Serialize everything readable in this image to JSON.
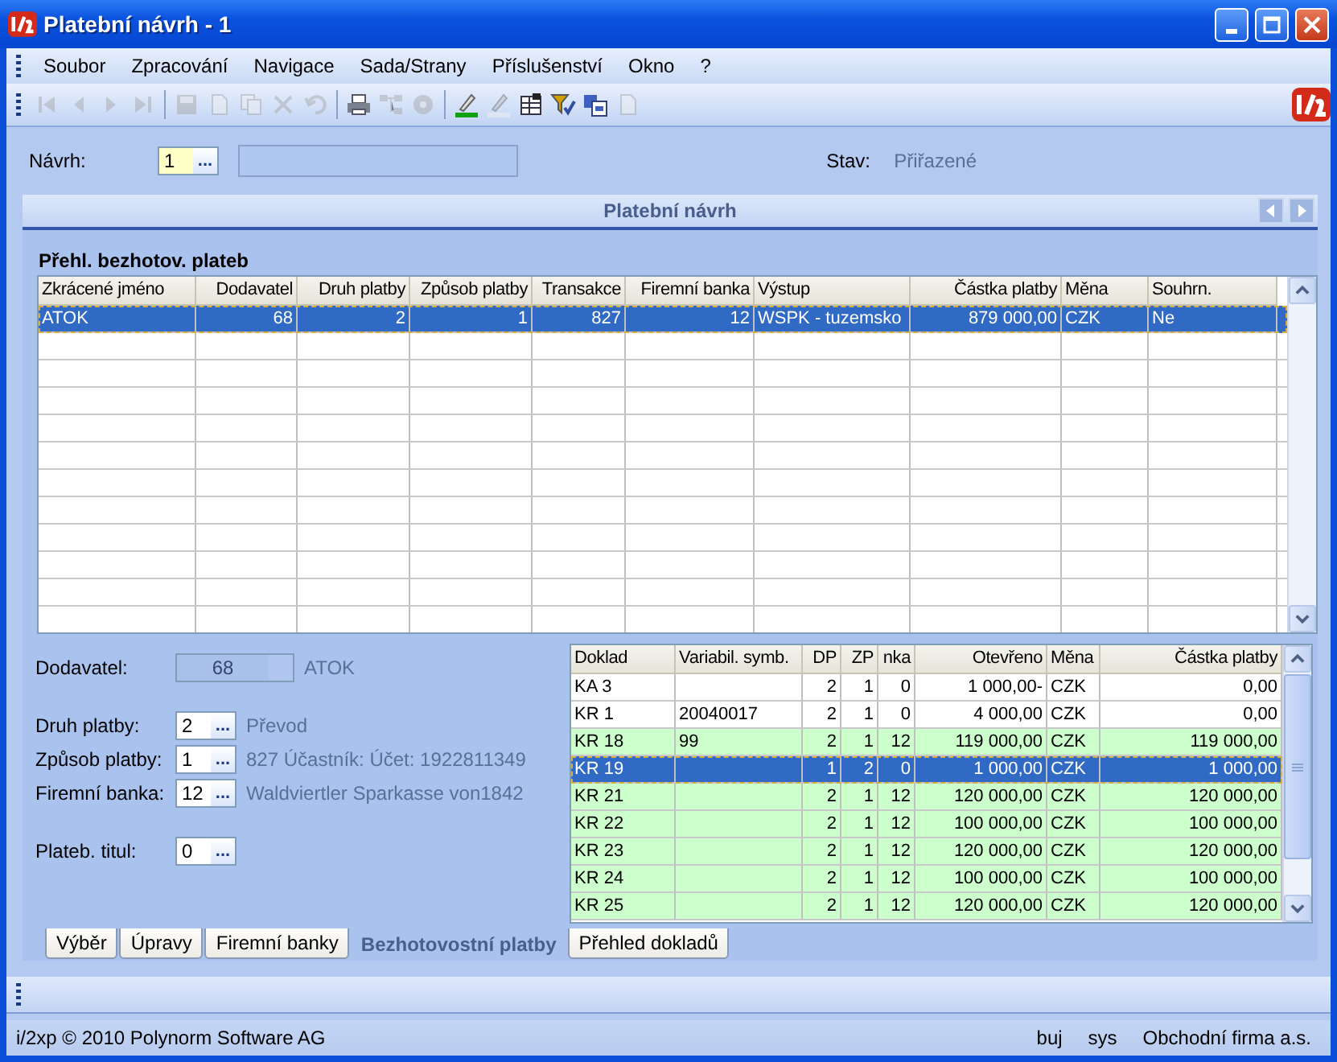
{
  "window": {
    "title": "Platební návrh - 1"
  },
  "menu": [
    "Soubor",
    "Zpracování",
    "Navigace",
    "Sada/Strany",
    "Příslušenství",
    "Okno",
    "?"
  ],
  "toolbar": [
    [
      {
        "kind": "first",
        "disabled": true
      },
      {
        "kind": "previous",
        "disabled": true
      },
      {
        "kind": "next",
        "disabled": true
      },
      {
        "kind": "last",
        "disabled": true
      }
    ],
    [
      {
        "kind": "save",
        "disabled": true
      },
      {
        "kind": "new",
        "disabled": true
      },
      {
        "kind": "copy",
        "disabled": true
      },
      {
        "kind": "delete",
        "disabled": true
      },
      {
        "kind": "undo",
        "disabled": true
      }
    ],
    [
      {
        "kind": "print",
        "disabled": false
      },
      {
        "kind": "tree",
        "disabled": true
      },
      {
        "kind": "disc",
        "disabled": true
      }
    ],
    [
      {
        "kind": "highlight",
        "disabled": false
      },
      {
        "kind": "erase",
        "disabled": true
      },
      {
        "kind": "table",
        "disabled": false
      },
      {
        "kind": "filter",
        "disabled": false
      },
      {
        "kind": "transfer",
        "disabled": false
      },
      {
        "kind": "document",
        "disabled": true
      }
    ]
  ],
  "header_form": {
    "label": "Návrh:",
    "value": "1",
    "button": "...",
    "status_label": "Stav:",
    "status_value": "Přiřazené"
  },
  "panel": {
    "title": "Platební návrh"
  },
  "payments": {
    "title": "Přehl. bezhotov. plateb",
    "columns": [
      {
        "label": "Zkrácené jméno",
        "kind": "text"
      },
      {
        "label": "Dodavatel",
        "kind": "number"
      },
      {
        "label": "Druh platby",
        "kind": "number"
      },
      {
        "label": "Způsob platby",
        "kind": "number"
      },
      {
        "label": "Transakce",
        "kind": "number"
      },
      {
        "label": "Firemní banka",
        "kind": "number"
      },
      {
        "label": "Výstup",
        "kind": "text"
      },
      {
        "label": "Částka platby",
        "kind": "number"
      },
      {
        "label": "Měna",
        "kind": "text"
      },
      {
        "label": "Souhrn.",
        "kind": "text"
      }
    ],
    "rows": [
      {
        "cells": [
          "ATOK",
          "68",
          "2",
          "1",
          "827",
          "12",
          "WSPK - tuzemsko",
          "879 000,00",
          "CZK",
          "Ne"
        ],
        "selected": true
      }
    ]
  },
  "details": {
    "field_groups": [
      [
        {
          "label": "Dodavatel:",
          "value": "68",
          "text": "ATOK",
          "disabled": true
        }
      ],
      [
        {
          "label": "Druh platby:",
          "value": "2",
          "button": "...",
          "text": "Převod",
          "disabled": false
        },
        {
          "label": "Způsob platby:",
          "value": "1",
          "button": "...",
          "text": "827 Účastník:  Účet: 1922811349",
          "disabled": false
        },
        {
          "label": "Firemní banka:",
          "value": "12",
          "button": "...",
          "text": "Waldviertler Sparkasse von1842",
          "disabled": false
        }
      ],
      [
        {
          "label": "Plateb. titul:",
          "value": "0",
          "button": "...",
          "disabled": false
        }
      ]
    ]
  },
  "documents": {
    "columns": [
      {
        "label": "Doklad",
        "kind": "text"
      },
      {
        "label": "Variabil. symb.",
        "kind": "text"
      },
      {
        "label": "DP",
        "kind": "number"
      },
      {
        "label": "ZP",
        "kind": "number"
      },
      {
        "label": "nka",
        "kind": "number"
      },
      {
        "label": "Otevřeno",
        "kind": "number"
      },
      {
        "label": "Měna",
        "kind": "text"
      },
      {
        "label": "Částka platby",
        "kind": "number"
      }
    ],
    "rows": [
      {
        "cells": [
          "KA 3",
          "",
          "2",
          "1",
          "0",
          "1 000,00-",
          "CZK",
          "0,00"
        ],
        "color": "#ffffff",
        "selected": false
      },
      {
        "cells": [
          "KR 1",
          "20040017",
          "2",
          "1",
          "0",
          "4 000,00",
          "CZK",
          "0,00"
        ],
        "color": "#ffffff",
        "selected": false
      },
      {
        "cells": [
          "KR 18",
          "99",
          "2",
          "1",
          "12",
          "119 000,00",
          "CZK",
          "119 000,00"
        ],
        "color": "#ccffcc",
        "selected": false
      },
      {
        "cells": [
          "KR 19",
          "",
          "1",
          "2",
          "0",
          "1 000,00",
          "CZK",
          "1 000,00"
        ],
        "selected": true
      },
      {
        "cells": [
          "KR 21",
          "",
          "2",
          "1",
          "12",
          "120 000,00",
          "CZK",
          "120 000,00"
        ],
        "color": "#ccffcc",
        "selected": false
      },
      {
        "cells": [
          "KR 22",
          "",
          "2",
          "1",
          "12",
          "100 000,00",
          "CZK",
          "100 000,00"
        ],
        "color": "#ccffcc",
        "selected": false
      },
      {
        "cells": [
          "KR 23",
          "",
          "2",
          "1",
          "12",
          "120 000,00",
          "CZK",
          "120 000,00"
        ],
        "color": "#ccffcc",
        "selected": false
      },
      {
        "cells": [
          "KR 24",
          "",
          "2",
          "1",
          "12",
          "100 000,00",
          "CZK",
          "100 000,00"
        ],
        "color": "#ccffcc",
        "selected": false
      },
      {
        "cells": [
          "KR 25",
          "",
          "2",
          "1",
          "12",
          "120 000,00",
          "CZK",
          "120 000,00"
        ],
        "color": "#ccffcc",
        "selected": false
      }
    ]
  },
  "tabs": [
    {
      "label": "Výběr",
      "selected": false
    },
    {
      "label": "Úpravy",
      "selected": false
    },
    {
      "label": "Firemní banky",
      "selected": false
    },
    {
      "label": "Bezhotovostní platby",
      "selected": true
    },
    {
      "label": "Přehled dokladů",
      "selected": false
    }
  ],
  "status_bar": [
    "i/2xp © 2010 Polynorm Software AG",
    "buj",
    "sys",
    "Obchodní firma a.s."
  ]
}
